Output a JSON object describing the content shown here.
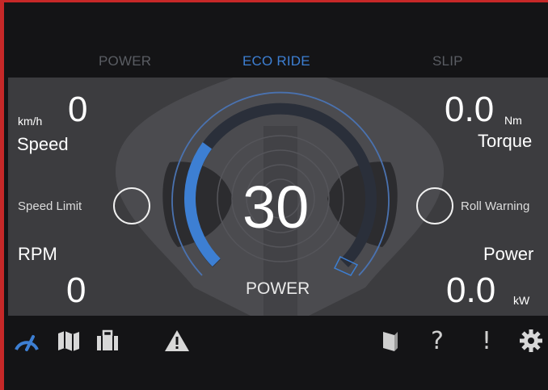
{
  "tabs": [
    {
      "label": "POWER",
      "active": false
    },
    {
      "label": "ECO RIDE",
      "active": true
    },
    {
      "label": "SLIP",
      "active": false
    }
  ],
  "speed": {
    "unit": "km/h",
    "value": "0",
    "label": "Speed"
  },
  "torque": {
    "value": "0.0",
    "unit": "Nm",
    "label": "Torque"
  },
  "speed_limit": {
    "label": "Speed Limit"
  },
  "roll_warning": {
    "label": "Roll Warning"
  },
  "rpm": {
    "label": "RPM",
    "value": "0"
  },
  "power": {
    "label": "Power",
    "value": "0.0",
    "unit": "kW"
  },
  "gauge": {
    "value": "30",
    "label": "POWER",
    "fill_fraction": 0.3
  },
  "toolbar": {
    "left_icons": [
      "gauge-icon",
      "map-icon",
      "briefcase-icon",
      "warning-icon"
    ],
    "right_icons": [
      "book-icon",
      "help-icon",
      "alert-icon",
      "gear-icon"
    ],
    "help_glyph": "?",
    "alert_glyph": "!"
  },
  "colors": {
    "accent": "#3d7fd3",
    "background": "#141416",
    "panel": "#3c3c3f",
    "frame_border": "#c62828"
  }
}
